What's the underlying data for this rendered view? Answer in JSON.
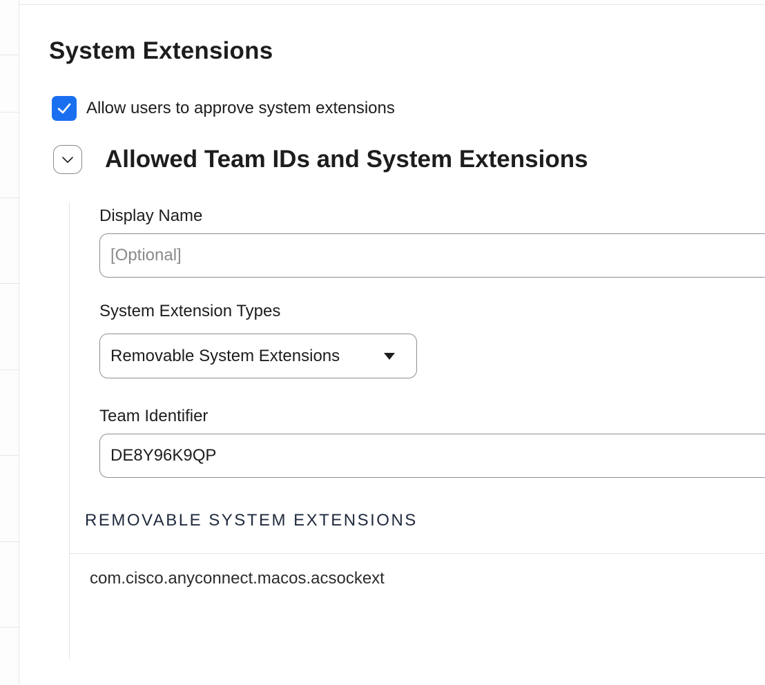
{
  "page": {
    "title": "System Extensions"
  },
  "allow_approval": {
    "label": "Allow users to approve system extensions",
    "checked": true
  },
  "section": {
    "title": "Allowed Team IDs and System Extensions",
    "expanded": true
  },
  "form": {
    "display_name": {
      "label": "Display Name",
      "placeholder": "[Optional]",
      "value": ""
    },
    "extension_types": {
      "label": "System Extension Types",
      "selected": "Removable System Extensions"
    },
    "team_identifier": {
      "label": "Team Identifier",
      "value": "DE8Y96K9QP"
    }
  },
  "extensions_list": {
    "header": "REMOVABLE SYSTEM EXTENSIONS",
    "items": [
      "com.cisco.anyconnect.macos.acsockext"
    ]
  },
  "icons": {
    "checkbox": "checkmark-icon",
    "collapse": "chevron-down-icon",
    "select": "caret-down-icon"
  },
  "colors": {
    "accent": "#1a6ff0",
    "text": "#1d1d1f",
    "border": "#8e8e93"
  }
}
